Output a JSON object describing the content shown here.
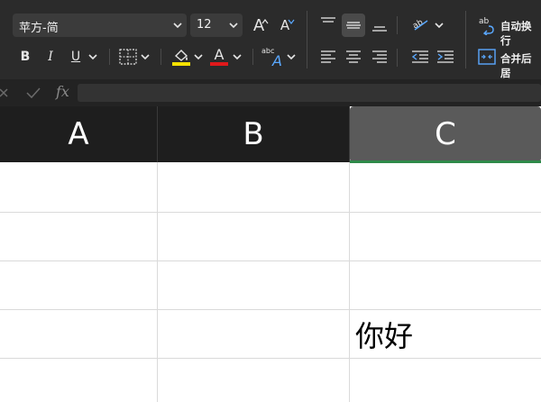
{
  "toolbar": {
    "font_name": "苹方-简",
    "font_size": "12",
    "grow_font": "A",
    "shrink_font": "A",
    "bold": "B",
    "italic": "I",
    "underline": "U",
    "font_color_label": "A",
    "highlight_color": "#f5e100",
    "font_color": "#e0191b",
    "wrap_text": "自动换行",
    "merge_center": "合并后居",
    "abc_label": "abc"
  },
  "formula_bar": {
    "fx_label": "fx",
    "content": ""
  },
  "sheet": {
    "columns": [
      "A",
      "B",
      "C"
    ],
    "selected_column": "C",
    "cells": [
      {
        "ref": "C4",
        "value": "你好"
      }
    ]
  }
}
